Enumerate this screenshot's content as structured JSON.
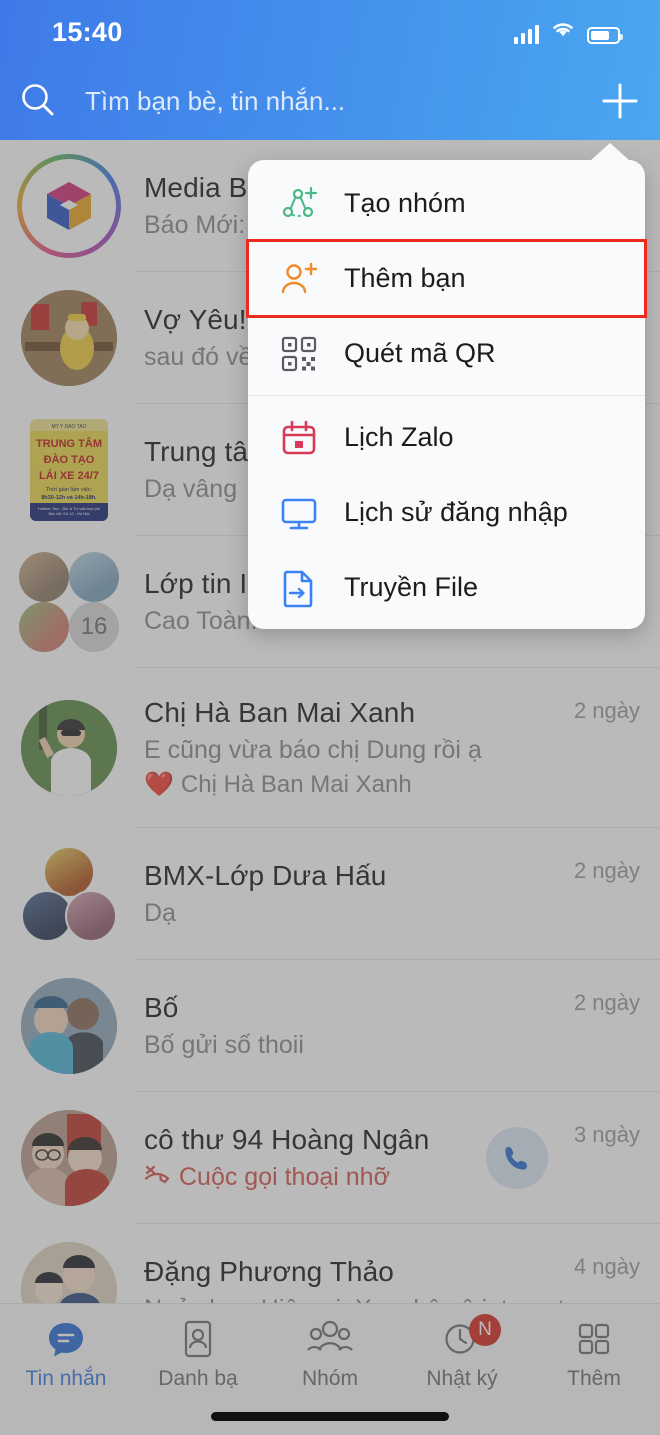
{
  "status_bar": {
    "time": "15:40",
    "signal_icon": "cellular-signal-icon",
    "wifi_icon": "wifi-icon",
    "battery_icon": "battery-icon"
  },
  "header": {
    "search_placeholder": "Tìm bạn bè, tin nhắn...",
    "search_icon": "search-icon",
    "add_icon": "plus-icon",
    "gradient_start": "#3f7ae8",
    "gradient_end": "#4aa7f0"
  },
  "popup_menu": {
    "items": [
      {
        "label": "Tạo nhóm",
        "icon": "create-group-icon",
        "color": "#4cb888",
        "highlighted": false
      },
      {
        "label": "Thêm bạn",
        "icon": "add-friend-icon",
        "color": "#ee8b2a",
        "highlighted": true
      },
      {
        "label": "Quét mã QR",
        "icon": "qr-scan-icon",
        "color": "#5a5a5f",
        "highlighted": false
      },
      {
        "label": "Lịch Zalo",
        "icon": "calendar-icon",
        "color": "#d93a57",
        "highlighted": false
      },
      {
        "label": "Lịch sử đăng nhập",
        "icon": "monitor-icon",
        "color": "#3b82f6",
        "highlighted": false
      },
      {
        "label": "Truyền File",
        "icon": "file-transfer-icon",
        "color": "#3b82f6",
        "highlighted": false
      }
    ],
    "highlight_color": "#ee2a1f",
    "divider_after_index": 2
  },
  "chat_list": [
    {
      "name": "Media Box",
      "preview": "Báo Mới: H",
      "time": "",
      "avatar_type": "cube-logo-ring",
      "has_call_icon": false
    },
    {
      "name": "Vợ Yêu!",
      "preview": "sau đó về",
      "time": "",
      "avatar_type": "photo-baby",
      "has_call_icon": false
    },
    {
      "name": "Trung tâm",
      "preview": "Dạ vâng",
      "time": "",
      "avatar_type": "poster-square",
      "has_call_icon": false
    },
    {
      "name": "Lớp tin IT",
      "preview": "Cao Toàn:",
      "time": "",
      "avatar_type": "group-grid-4",
      "member_count": "16",
      "has_call_icon": false
    },
    {
      "name": "Chị Hà Ban Mai Xanh",
      "preview": "E cũng vừa báo chị Dung rồi ạ",
      "preview2": "Chị Hà Ban Mai Xanh",
      "preview2_emoji": "❤️",
      "time": "2 ngày",
      "avatar_type": "photo-woman",
      "has_call_icon": false
    },
    {
      "name": "BMX-Lớp Dưa Hấu",
      "preview": "Dạ",
      "time": "2 ngày",
      "avatar_type": "group-grid-3",
      "has_call_icon": false
    },
    {
      "name": "Bố",
      "preview": "Bố gửi số thoii",
      "time": "2 ngày",
      "avatar_type": "photo-couple",
      "has_call_icon": false
    },
    {
      "name": "cô thư 94 Hoàng Ngân",
      "preview": "Cuộc gọi thoại nhỡ",
      "preview_missed": true,
      "time": "3 ngày",
      "avatar_type": "photo-two-girls",
      "has_call_icon": true,
      "call_icon": "phone-icon",
      "missed_call_icon": "missed-call-icon"
    },
    {
      "name": "Đặng Phương Thảo",
      "preview": "Ngủ chưa Hiệp ơi. Xem hộ cô internet với.",
      "time": "4 ngày",
      "avatar_type": "photo-mother-daughter",
      "has_call_icon": false
    }
  ],
  "tab_bar": {
    "active_index": 0,
    "active_color": "#3b7de0",
    "inactive_color": "#6e6e73",
    "tabs": [
      {
        "label": "Tin nhắn",
        "icon": "message-bubble-icon",
        "badge": ""
      },
      {
        "label": "Danh bạ",
        "icon": "contacts-icon",
        "badge": ""
      },
      {
        "label": "Nhóm",
        "icon": "group-people-icon",
        "badge": ""
      },
      {
        "label": "Nhật ký",
        "icon": "clock-icon",
        "badge": "N"
      },
      {
        "label": "Thêm",
        "icon": "grid-more-icon",
        "badge": ""
      }
    ]
  }
}
